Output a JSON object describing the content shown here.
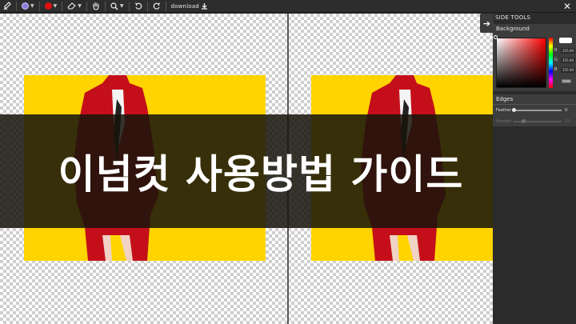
{
  "toolbar": {
    "download_label": "download",
    "brush_color": "#8a7bd8",
    "paint_color": "#e01010",
    "icons": [
      "pen-tool-icon",
      "color-dot-icon",
      "red-dot-icon",
      "eraser-icon",
      "hand-icon",
      "zoom-icon",
      "undo-icon",
      "redo-icon",
      "download-icon",
      "close-icon"
    ]
  },
  "banner": {
    "title": "이넘컷 사용방법 가이드"
  },
  "side_panel": {
    "title": "SIDE TOOLS",
    "background_label": "Background",
    "r_label": "R",
    "r_value": "255.00",
    "g_label": "G",
    "g_value": "255.00",
    "b_label": "B",
    "b_value": "255.00",
    "edges_label": "Edges",
    "feather_label": "Feather",
    "feather_value": "0",
    "smooth_label": "Smooth",
    "smooth_value": "15"
  },
  "colors": {
    "photo_background": "#ffd400",
    "accent_red": "#e01010"
  }
}
